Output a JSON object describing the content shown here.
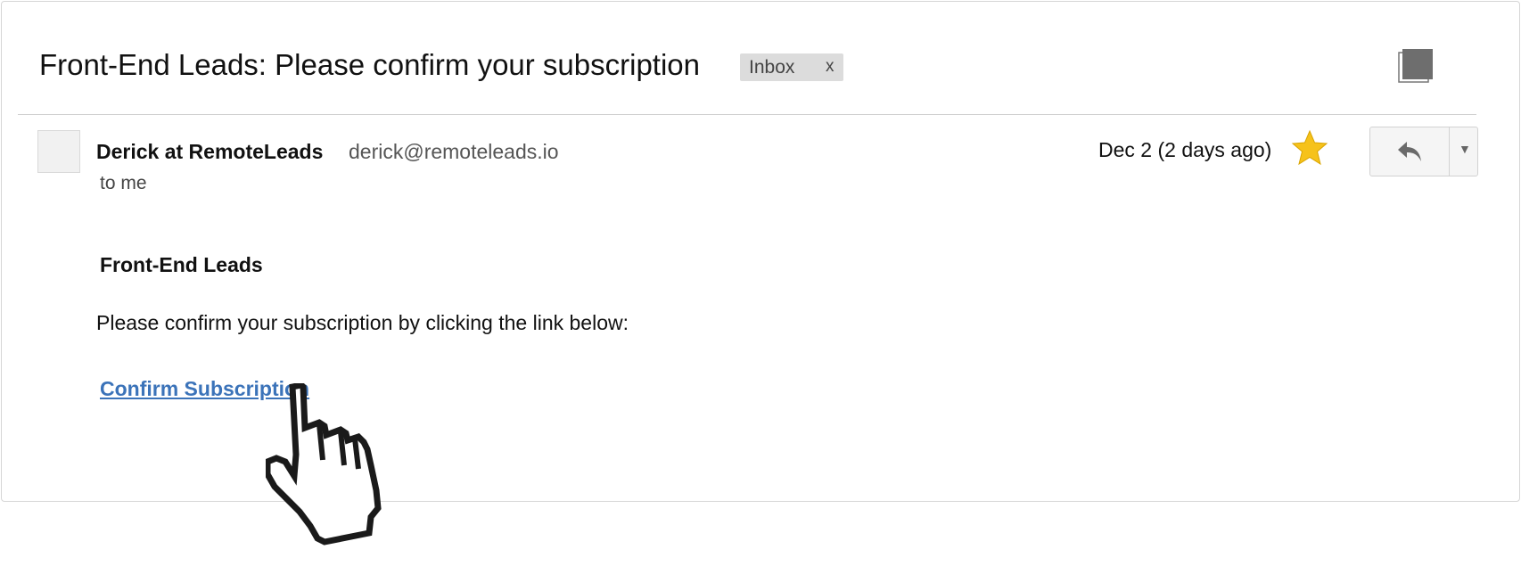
{
  "email": {
    "subject": "Front-End Leads: Please confirm your subscription",
    "label_chip": {
      "label": "Inbox",
      "remove": "x"
    },
    "sender": {
      "name": "Derick at RemoteLeads",
      "email": "derick@remoteleads.io"
    },
    "recipient": "to me",
    "date": "Dec 2 (2 days ago)",
    "starred": true,
    "body": {
      "heading": "Front-End Leads",
      "text": "Please confirm your subscription by clicking the link below:",
      "link": "Confirm Subscription"
    }
  },
  "icons": {
    "print": "print-icon",
    "star": "star-icon",
    "reply": "reply-icon",
    "more": "chevron-down-icon",
    "cursor": "hand-cursor-icon"
  },
  "colors": {
    "link": "#3b73b9",
    "star": "#f6c21a",
    "chip_bg": "#dcdcdc"
  }
}
